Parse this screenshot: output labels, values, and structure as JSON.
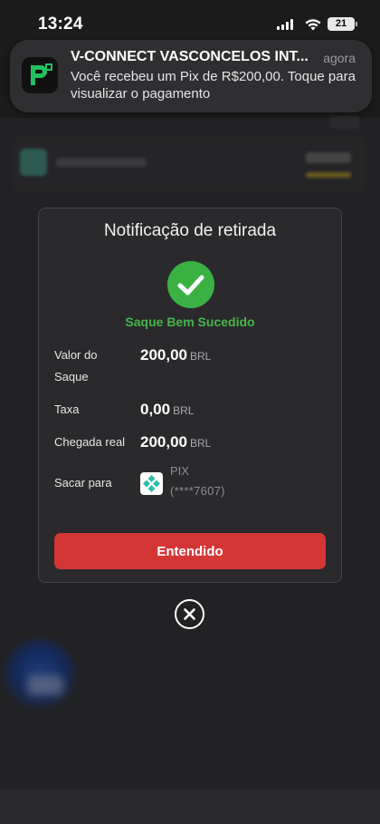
{
  "status_bar": {
    "time": "13:24",
    "battery": "21"
  },
  "notification": {
    "app_icon": "picpay-p-icon",
    "title": "V-CONNECT VASCONCELOS INT...",
    "time": "agora",
    "body": "Você recebeu um Pix de R$200,00. Toque para visualizar o pagamento",
    "accent": "#21c25e"
  },
  "modal": {
    "title": "Notificação de retirada",
    "status_icon": "check-circle-icon",
    "status_text": "Saque Bem Sucedido",
    "status_color": "#46b64a",
    "rows": [
      {
        "label": "Valor do Saque",
        "amount": "200,00",
        "currency": "BRL"
      },
      {
        "label": "Taxa",
        "amount": "0,00",
        "currency": "BRL"
      },
      {
        "label": "Chegada real",
        "amount": "200,00",
        "currency": "BRL"
      }
    ],
    "payout": {
      "label": "Sacar para",
      "method_icon": "pix-icon",
      "method": "PIX",
      "account": "(****7607)"
    },
    "button_label": "Entendido",
    "button_color": "#d43636"
  },
  "close_icon": "close-circle-icon"
}
